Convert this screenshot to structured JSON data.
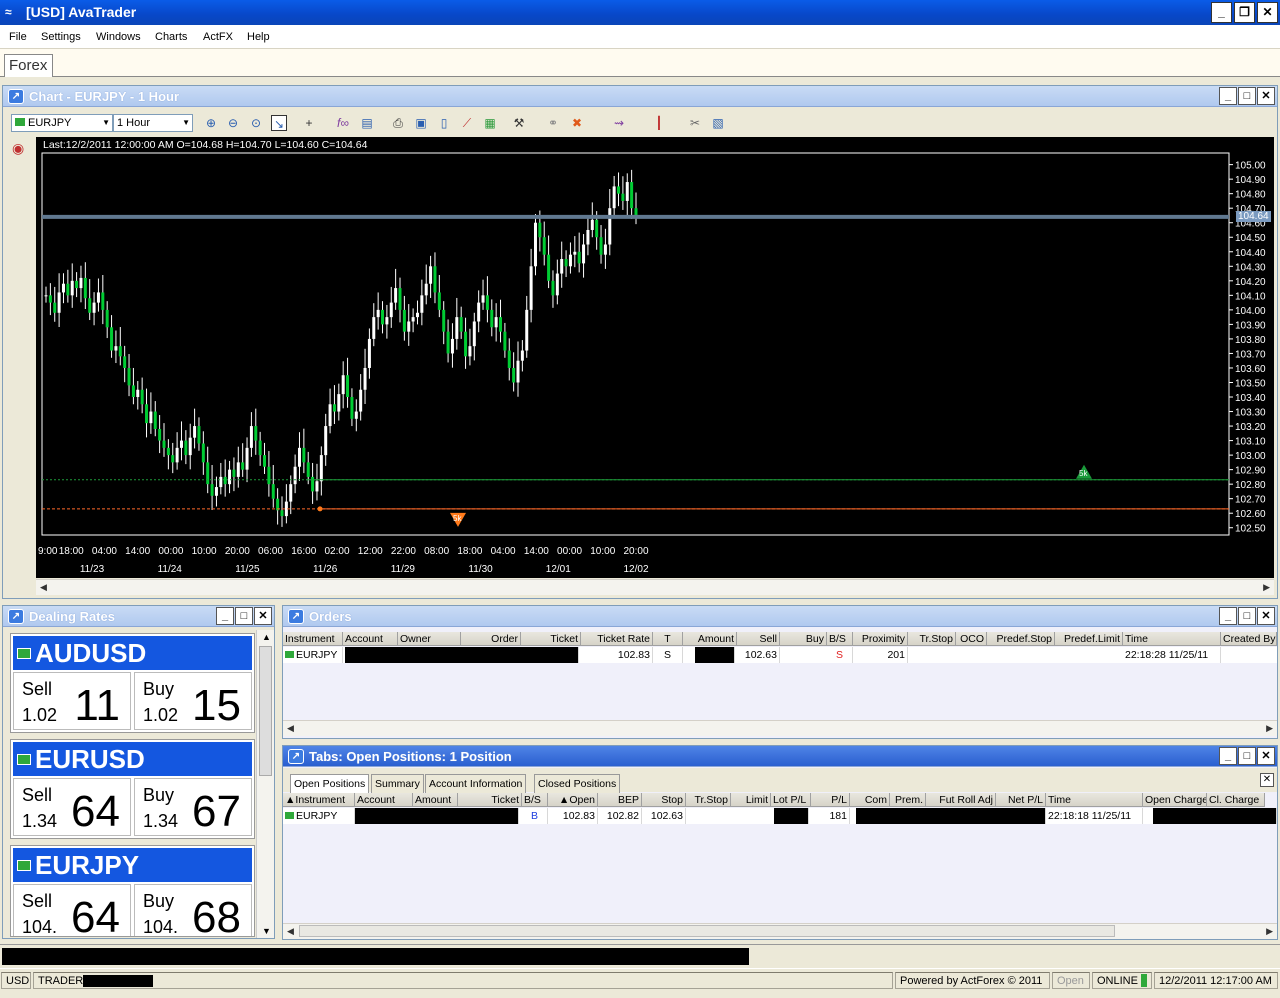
{
  "window": {
    "title": "[USD] AvaTrader"
  },
  "menu": [
    "File",
    "Settings",
    "Windows",
    "Charts",
    "ActFX",
    "Help"
  ],
  "workspace_tab": "Forex",
  "chart_panel": {
    "title": "Chart - EURJPY - 1 Hour",
    "instrument": "EURJPY",
    "timeframe": "1 Hour",
    "last_info": "Last:12/2/2011 12:00:00 AM O=104.68 H=104.70 L=104.60 C=104.64",
    "current_price_label": "104.64",
    "order_marker_label": "5k",
    "position_marker_label": "5k"
  },
  "chart_data": {
    "type": "candlestick",
    "instrument": "EURJPY",
    "ylim": [
      102.45,
      105.08
    ],
    "y_ticks": [
      "105.00",
      "104.90",
      "104.80",
      "104.70",
      "104.60",
      "104.50",
      "104.40",
      "104.30",
      "104.20",
      "104.10",
      "104.00",
      "103.90",
      "103.80",
      "103.70",
      "103.60",
      "103.50",
      "103.40",
      "103.30",
      "103.20",
      "103.10",
      "103.00",
      "102.90",
      "102.80",
      "102.70",
      "102.60",
      "102.50"
    ],
    "x_ticks": [
      "9:00",
      "18:00",
      "04:00",
      "14:00",
      "00:00",
      "10:00",
      "20:00",
      "06:00",
      "16:00",
      "02:00",
      "12:00",
      "22:00",
      "08:00",
      "18:00",
      "04:00",
      "14:00",
      "00:00",
      "10:00",
      "20:00"
    ],
    "date_labels": [
      "11/23",
      "11/24",
      "11/25",
      "11/26",
      "11/29",
      "11/30",
      "12/01",
      "12/02"
    ],
    "current_price": 104.64,
    "order_line": 102.83,
    "position_line": 102.63,
    "closes": [
      104.1,
      104.05,
      103.98,
      104.12,
      104.18,
      104.1,
      104.2,
      104.15,
      104.22,
      104.08,
      103.98,
      104.05,
      104.12,
      104.0,
      103.88,
      103.72,
      103.75,
      103.68,
      103.6,
      103.48,
      103.4,
      103.45,
      103.35,
      103.22,
      103.3,
      103.18,
      103.1,
      103.05,
      103.0,
      102.95,
      103.05,
      103.1,
      103.0,
      103.12,
      103.2,
      103.08,
      102.95,
      102.8,
      102.72,
      102.78,
      102.85,
      102.8,
      102.9,
      102.85,
      102.95,
      102.9,
      103.05,
      103.2,
      103.1,
      103.0,
      102.92,
      102.8,
      102.7,
      102.62,
      102.58,
      102.68,
      102.8,
      102.92,
      103.05,
      102.95,
      102.85,
      102.75,
      102.82,
      103.0,
      103.2,
      103.35,
      103.3,
      103.42,
      103.55,
      103.4,
      103.25,
      103.3,
      103.45,
      103.6,
      103.8,
      103.95,
      104.0,
      103.9,
      103.95,
      104.05,
      104.15,
      104.0,
      103.85,
      103.92,
      103.95,
      103.98,
      104.1,
      104.18,
      104.3,
      104.12,
      104.0,
      103.85,
      103.7,
      103.8,
      103.95,
      103.85,
      103.68,
      103.75,
      103.92,
      104.05,
      104.1,
      104.0,
      103.88,
      103.95,
      103.85,
      103.72,
      103.6,
      103.5,
      103.65,
      103.72,
      104.0,
      104.3,
      104.6,
      104.5,
      104.38,
      104.2,
      104.1,
      104.25,
      104.35,
      104.3,
      104.38,
      104.4,
      104.32,
      104.45,
      104.55,
      104.62,
      104.5,
      104.38,
      104.45,
      104.7,
      104.85,
      104.8,
      104.75,
      104.88,
      104.7,
      104.64
    ]
  },
  "dealing_rates": {
    "title": "Dealing Rates",
    "pairs": [
      {
        "name": "AUDUSD",
        "sell_label": "Sell",
        "sell_small": "1.02",
        "sell_big": "11",
        "buy_label": "Buy",
        "buy_small": "1.02",
        "buy_big": "15"
      },
      {
        "name": "EURUSD",
        "sell_label": "Sell",
        "sell_small": "1.34",
        "sell_big": "64",
        "buy_label": "Buy",
        "buy_small": "1.34",
        "buy_big": "67"
      },
      {
        "name": "EURJPY",
        "sell_label": "Sell",
        "sell_small": "104.",
        "sell_big": "64",
        "buy_label": "Buy",
        "buy_small": "104.",
        "buy_big": "68"
      }
    ]
  },
  "orders": {
    "title": "Orders",
    "columns": [
      "Instrument",
      "Account",
      "Owner",
      "Order",
      "Ticket",
      "Ticket Rate",
      "T",
      "Amount",
      "Sell",
      "Buy",
      "B/S",
      "Proximity",
      "Tr.Stop",
      "OCO",
      "Predef.Stop",
      "Predef.Limit",
      "Time",
      "Created By"
    ],
    "row": {
      "instrument": "EURJPY",
      "ticket_rate": "102.83",
      "t": "S",
      "sell": "102.63",
      "bs": "S",
      "proximity": "201",
      "time": "22:18:28 11/25/11"
    }
  },
  "positions": {
    "title": "Tabs: Open Positions: 1 Position",
    "tabs": [
      "Open Positions",
      "Summary",
      "Account Information",
      "Closed Positions"
    ],
    "columns": [
      "Instrument",
      "Account",
      "Amount",
      "Ticket",
      "B/S",
      "Open",
      "BEP",
      "Stop",
      "Tr.Stop",
      "Limit",
      "Lot P/L",
      "P/L",
      "Com",
      "Prem.",
      "Fut Roll Adj",
      "Net P/L",
      "Time",
      "Open Charge",
      "Cl. Charge"
    ],
    "row": {
      "instrument": "EURJPY",
      "bs": "B",
      "open": "102.83",
      "bep": "102.82",
      "stop": "102.63",
      "pl": "181",
      "time": "22:18:18 11/25/11"
    }
  },
  "status": {
    "currency": "USD",
    "user": "TRADER",
    "powered": "Powered by ActForex © 2011",
    "open": "Open",
    "online": "ONLINE",
    "datetime": "12/2/2011 12:17:00 AM"
  },
  "colors": {
    "candle_up": "#ffffff",
    "candle_down": "#00cc33",
    "order_line": "#1e9a3a",
    "position_line": "#ff6a2a",
    "price_line": "#607890"
  }
}
